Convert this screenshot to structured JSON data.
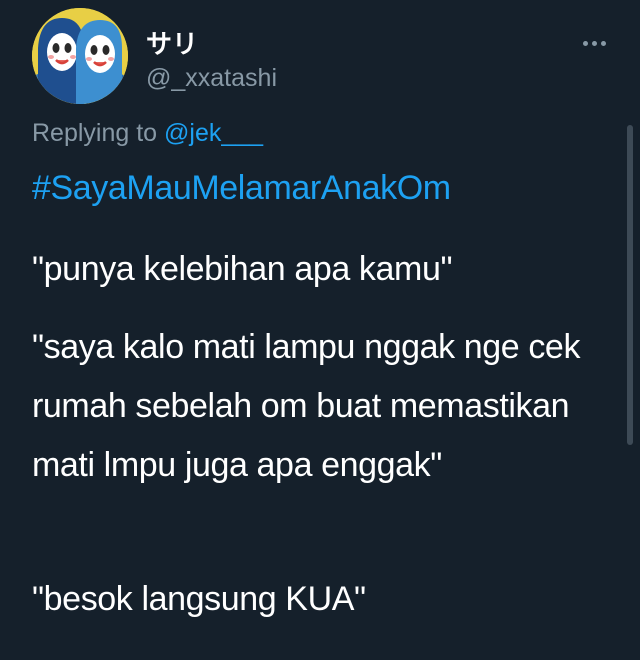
{
  "tweet": {
    "author": {
      "display_name": "サリ",
      "handle": "@_xxatashi"
    },
    "reply": {
      "prefix": "Replying to",
      "mention": "@jek___"
    },
    "hashtag": "#SayaMauMelamarAnakOm",
    "paragraphs": [
      "\"punya kelebihan apa kamu\"",
      "\"saya kalo mati lampu nggak nge cek rumah sebelah om buat memastikan mati lmpu juga apa enggak\"",
      "\"besok langsung KUA\""
    ]
  },
  "icons": {
    "more": "more-horizontal-icon",
    "avatar": "avatar-image"
  },
  "colors": {
    "background": "#15202b",
    "text": "#ffffff",
    "secondary": "#8899a6",
    "link": "#1da1f2"
  }
}
